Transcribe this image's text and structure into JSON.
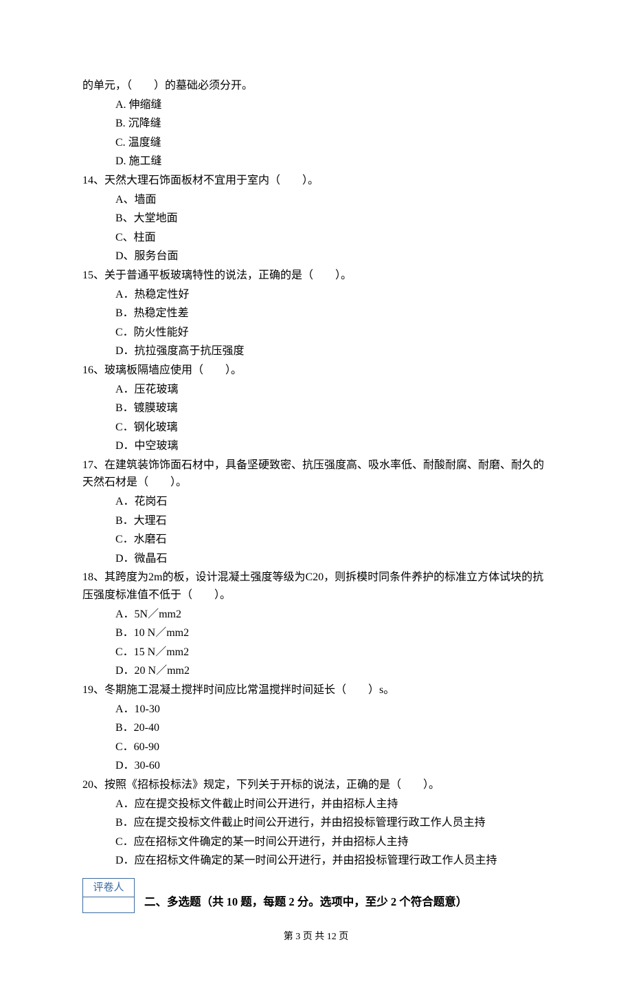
{
  "q13": {
    "stem_continued": "的单元，（　　）的墓础必须分开。",
    "options": [
      "A. 伸缩缝",
      "B. 沉降缝",
      "C. 温度缝",
      "D. 施工缝"
    ]
  },
  "q14": {
    "stem": "14、天然大理石饰面板材不宜用于室内（　　）。",
    "options": [
      "A、墙面",
      "B、大堂地面",
      "C、柱面",
      "D、服务台面"
    ]
  },
  "q15": {
    "stem": "15、关于普通平板玻璃特性的说法，正确的是（　　）。",
    "options": [
      "A．热稳定性好",
      "B．热稳定性差",
      "C．防火性能好",
      "D．抗拉强度高于抗压强度"
    ]
  },
  "q16": {
    "stem": "16、玻璃板隔墙应使用（　　）。",
    "options": [
      "A．压花玻璃",
      "B．镀膜玻璃",
      "C．钢化玻璃",
      "D．中空玻璃"
    ]
  },
  "q17": {
    "stem": "17、在建筑装饰饰面石材中，具备坚硬致密、抗压强度高、吸水率低、耐酸耐腐、耐磨、耐久的天然石材是（　　）。",
    "options": [
      "A．花岗石",
      "B．大理石",
      "C．水磨石",
      "D．微晶石"
    ]
  },
  "q18": {
    "stem": "18、其跨度为2m的板，设计混凝土强度等级为C20，则拆模时同条件养护的标准立方体试块的抗压强度标准值不低于（　　）。",
    "options": [
      "A．5N／mm2",
      "B．10 N／mm2",
      "C．15 N／mm2",
      "D．20 N／mm2"
    ]
  },
  "q19": {
    "stem": "19、冬期施工混凝土搅拌时间应比常温搅拌时间延长（　　）s。",
    "options": [
      "A．10-30",
      "B．20-40",
      "C．60-90",
      "D．30-60"
    ]
  },
  "q20": {
    "stem": "20、按照《招标投标法》规定，下列关于开标的说法，正确的是（　　）。",
    "options": [
      "A．应在提交投标文件截止时间公开进行，并由招标人主持",
      "B．应在提交投标文件截止时间公开进行，并由招投标管理行政工作人员主持",
      "C．应在招标文件确定的某一时间公开进行，并由招标人主持",
      "D．应在招标文件确定的某一时间公开进行，并由招投标管理行政工作人员主持"
    ]
  },
  "scorer_label": "评卷人",
  "section2_title": "二、多选题（共 10 题，每题 2 分。选项中，至少 2 个符合题意）",
  "footer": "第 3 页 共 12 页"
}
